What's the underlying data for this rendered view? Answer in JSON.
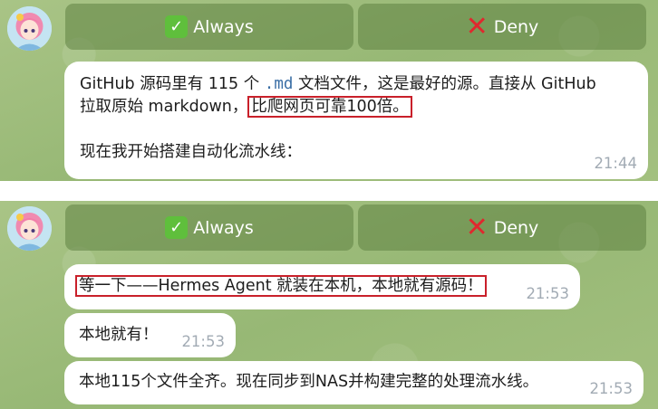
{
  "top_panel": {
    "buttons": {
      "always_label": "Always",
      "deny_label": "Deny"
    },
    "message": {
      "line1_a": "GitHub 源码里有 115 个 ",
      "line1_code": ".md",
      "line1_b": " 文档文件，这是最好的源。直接从 GitHub",
      "line2_a": "拉取原始 markdown，",
      "line2_highlight": "比爬网页可靠100倍。",
      "line3": "现在我开始搭建自动化流水线：",
      "time": "21:44"
    }
  },
  "bottom_panel": {
    "buttons": {
      "always_label": "Always",
      "deny_label": "Deny"
    },
    "messages": [
      {
        "text": "等一下——Hermes Agent 就装在本机，本地就有源码！",
        "time": "21:53",
        "highlighted": true
      },
      {
        "text": "本地就有！",
        "time": "21:53",
        "highlighted": false
      },
      {
        "text": "本地115个文件全齐。现在同步到NAS并构建完整的处理流水线。",
        "time": "21:53",
        "highlighted": false
      }
    ]
  },
  "icons": {
    "always": "white-check-mark-emoji",
    "deny": "cross-mark-emoji",
    "avatar": "anime-girl-avatar"
  },
  "colors": {
    "button_bg": "#5e8242",
    "highlight_border": "#c9202a",
    "check_green": "#5fbf3c",
    "cross_red": "#e0282e",
    "timestamp": "#a2abb4"
  }
}
